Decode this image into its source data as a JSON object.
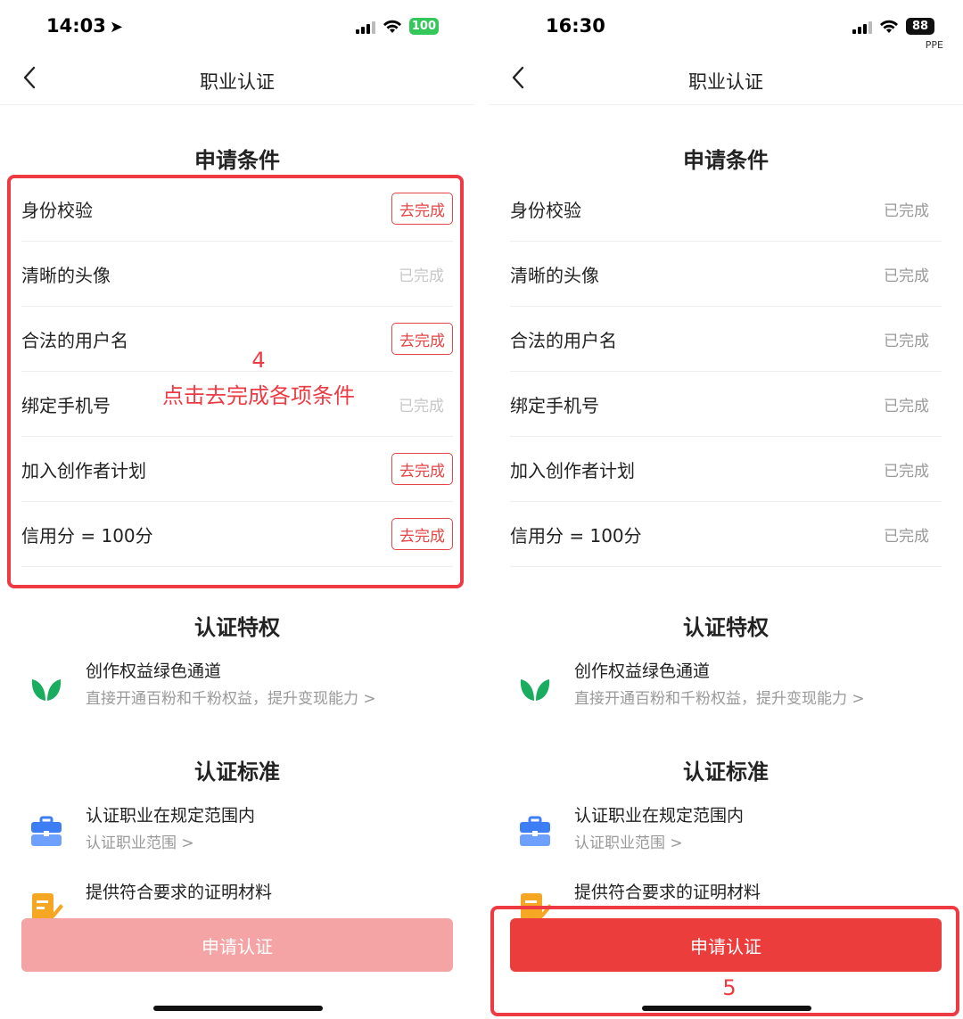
{
  "left_screen": {
    "status": {
      "time": "14:03",
      "battery": "100"
    },
    "nav": {
      "title": "职业认证"
    },
    "conditions_title": "申请条件",
    "conditions": [
      {
        "label": "身份校验",
        "status": "去完成"
      },
      {
        "label": "清晰的头像",
        "status": "已完成"
      },
      {
        "label": "合法的用户名",
        "status": "去完成"
      },
      {
        "label": "绑定手机号",
        "status": "已完成"
      },
      {
        "label": "加入创作者计划",
        "status": "去完成"
      },
      {
        "label": "信用分 = 100分",
        "status": "去完成"
      }
    ],
    "privileges_title": "认证特权",
    "privilege": {
      "title": "创作权益绿色通道",
      "subtitle": "直接开通百粉和千粉权益，提升变现能力 >"
    },
    "standards_title": "认证标准",
    "standards": [
      {
        "title": "认证职业在规定范围内",
        "subtitle": "认证职业范围 >"
      },
      {
        "title": "提供符合要求的证明材料",
        "subtitle": ""
      }
    ],
    "apply_label": "申请认证",
    "annotation": {
      "step": "4",
      "text": "点击去完成各项条件"
    }
  },
  "right_screen": {
    "status": {
      "time": "16:30",
      "battery": "88",
      "carrier_tag": "PPE"
    },
    "nav": {
      "title": "职业认证"
    },
    "conditions_title": "申请条件",
    "conditions": [
      {
        "label": "身份校验",
        "status": "已完成"
      },
      {
        "label": "清晰的头像",
        "status": "已完成"
      },
      {
        "label": "合法的用户名",
        "status": "已完成"
      },
      {
        "label": "绑定手机号",
        "status": "已完成"
      },
      {
        "label": "加入创作者计划",
        "status": "已完成"
      },
      {
        "label": "信用分 = 100分",
        "status": "已完成"
      }
    ],
    "privileges_title": "认证特权",
    "privilege": {
      "title": "创作权益绿色通道",
      "subtitle": "直接开通百粉和千粉权益，提升变现能力 >"
    },
    "standards_title": "认证标准",
    "standards": [
      {
        "title": "认证职业在规定范围内",
        "subtitle": "认证职业范围 >"
      },
      {
        "title": "提供符合要求的证明材料",
        "subtitle": ""
      }
    ],
    "apply_label": "申请认证",
    "annotation": {
      "step": "5"
    }
  },
  "colors": {
    "accent_red": "#ec3d3d",
    "annotation_red": "#ee3b43",
    "disabled_button": "#f4a4a4",
    "leaf_green": "#1aad5f",
    "briefcase_blue": "#3d7ef5",
    "doc_orange": "#f5a623"
  },
  "icons": [
    "location-arrow-icon",
    "signal-icon",
    "wifi-icon",
    "battery-icon",
    "back-chevron-icon",
    "leaf-icon",
    "briefcase-icon",
    "document-edit-icon"
  ]
}
